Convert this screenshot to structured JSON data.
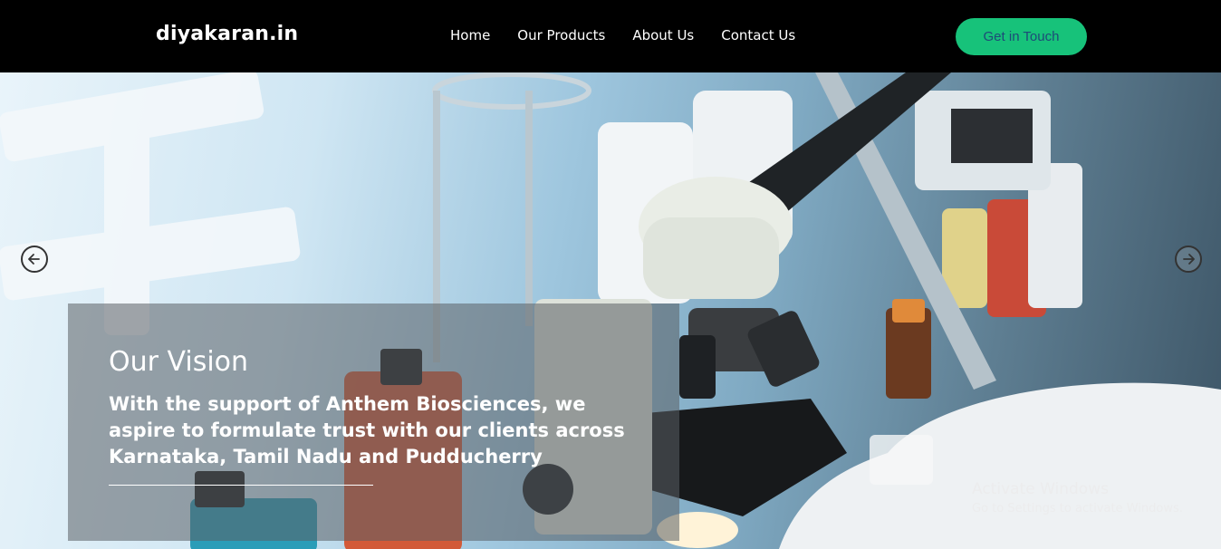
{
  "brand": {
    "logo": "diyakaran.in"
  },
  "nav": {
    "items": [
      {
        "label": "Home"
      },
      {
        "label": "Our Products"
      },
      {
        "label": "About Us"
      },
      {
        "label": "Contact Us"
      }
    ],
    "cta_label": "Get in Touch"
  },
  "hero": {
    "slide": {
      "title": "Our Vision",
      "text": "With the support of Anthem Biosciences, we aspire to formulate trust with our clients across Karnataka, Tamil Nadu and Pudducherry"
    }
  },
  "watermark": {
    "title": "Activate Windows",
    "subtitle": "Go to Settings to activate Windows."
  },
  "colors": {
    "navbar_bg": "#000000",
    "cta_bg": "#17c27a",
    "cta_text": "#1e4a78"
  },
  "icons": {
    "prev": "arrow-left-circle-icon",
    "next": "arrow-right-circle-icon"
  }
}
